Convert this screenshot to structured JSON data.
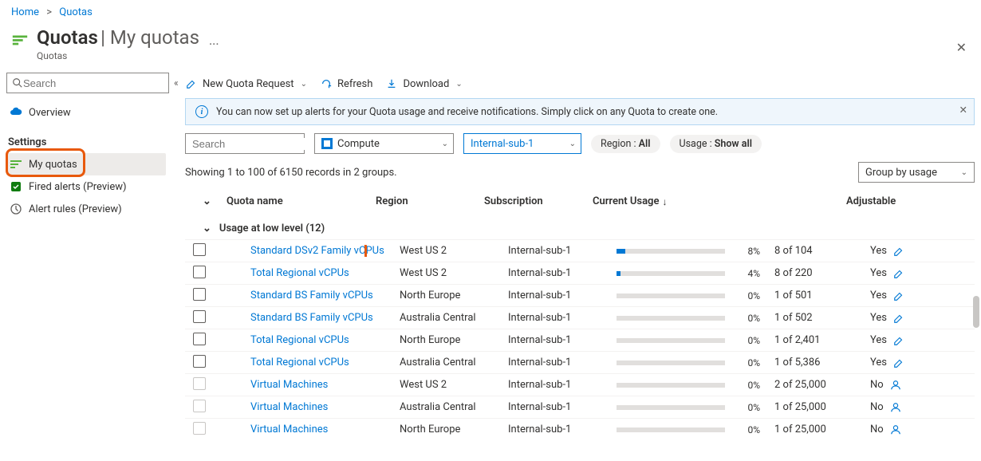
{
  "breadcrumbs": {
    "home": "Home",
    "quotas": "Quotas"
  },
  "header": {
    "title": "Quotas",
    "subtitle": "My quotas",
    "type": "Quotas"
  },
  "sidebar": {
    "search_placeholder": "Search",
    "overview": "Overview",
    "settings_heading": "Settings",
    "my_quotas": "My quotas",
    "fired_alerts": "Fired alerts (Preview)",
    "alert_rules": "Alert rules (Preview)"
  },
  "toolbar": {
    "new_quota": "New Quota Request",
    "refresh": "Refresh",
    "download": "Download"
  },
  "banner": {
    "text": "You can now set up alerts for your Quota usage and receive notifications. Simply click on any Quota to create one."
  },
  "filters": {
    "search_placeholder": "Search",
    "provider": "Compute",
    "subscription": "Internal-sub-1",
    "region_pill_label": "Region : ",
    "region_pill_value": "All",
    "usage_pill_label": "Usage : ",
    "usage_pill_value": "Show all"
  },
  "status": {
    "count_text": "Showing 1 to 100 of 6150 records in 2 groups.",
    "group_by": "Group by usage"
  },
  "columns": {
    "name": "Quota name",
    "region": "Region",
    "subscription": "Subscription",
    "usage": "Current Usage",
    "adjustable": "Adjustable"
  },
  "group": {
    "label": "Usage at low level (12)"
  },
  "rows": [
    {
      "name": "Standard DSv2 Family vCPUs",
      "region": "West US 2",
      "subscription": "Internal-sub-1",
      "pct": "8%",
      "fill": 8,
      "of": "8 of 104",
      "adj": "Yes",
      "adj_icon": "edit",
      "highlight": true,
      "check_disabled": false
    },
    {
      "name": "Total Regional vCPUs",
      "region": "West US 2",
      "subscription": "Internal-sub-1",
      "pct": "4%",
      "fill": 4,
      "of": "8 of 220",
      "adj": "Yes",
      "adj_icon": "edit",
      "highlight": false,
      "check_disabled": false
    },
    {
      "name": "Standard BS Family vCPUs",
      "region": "North Europe",
      "subscription": "Internal-sub-1",
      "pct": "0%",
      "fill": 0,
      "of": "1 of 501",
      "adj": "Yes",
      "adj_icon": "edit",
      "highlight": false,
      "check_disabled": false
    },
    {
      "name": "Standard BS Family vCPUs",
      "region": "Australia Central",
      "subscription": "Internal-sub-1",
      "pct": "0%",
      "fill": 0,
      "of": "1 of 502",
      "adj": "Yes",
      "adj_icon": "edit",
      "highlight": false,
      "check_disabled": false
    },
    {
      "name": "Total Regional vCPUs",
      "region": "North Europe",
      "subscription": "Internal-sub-1",
      "pct": "0%",
      "fill": 0,
      "of": "1 of 2,401",
      "adj": "Yes",
      "adj_icon": "edit",
      "highlight": false,
      "check_disabled": false
    },
    {
      "name": "Total Regional vCPUs",
      "region": "Australia Central",
      "subscription": "Internal-sub-1",
      "pct": "0%",
      "fill": 0,
      "of": "1 of 5,386",
      "adj": "Yes",
      "adj_icon": "edit",
      "highlight": false,
      "check_disabled": false
    },
    {
      "name": "Virtual Machines",
      "region": "West US 2",
      "subscription": "Internal-sub-1",
      "pct": "0%",
      "fill": 0,
      "of": "2 of 25,000",
      "adj": "No",
      "adj_icon": "person",
      "highlight": false,
      "check_disabled": true
    },
    {
      "name": "Virtual Machines",
      "region": "Australia Central",
      "subscription": "Internal-sub-1",
      "pct": "0%",
      "fill": 0,
      "of": "1 of 25,000",
      "adj": "No",
      "adj_icon": "person",
      "highlight": false,
      "check_disabled": true
    },
    {
      "name": "Virtual Machines",
      "region": "North Europe",
      "subscription": "Internal-sub-1",
      "pct": "0%",
      "fill": 0,
      "of": "1 of 25,000",
      "adj": "No",
      "adj_icon": "person",
      "highlight": false,
      "check_disabled": true
    }
  ]
}
